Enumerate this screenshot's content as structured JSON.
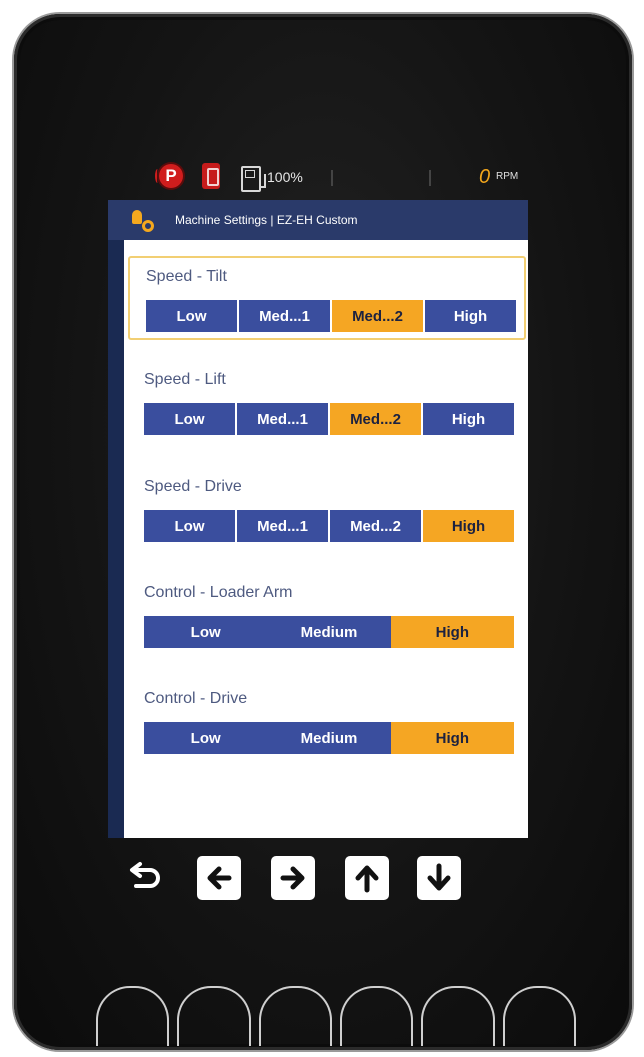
{
  "status": {
    "fuel_text": "100%",
    "rpm_value": "0",
    "rpm_unit": "RPM"
  },
  "header": {
    "title": "Machine Settings | EZ-EH Custom"
  },
  "settings": [
    {
      "label": "Speed - Tilt",
      "options": [
        "Low",
        "Med...1",
        "Med...2",
        "High"
      ],
      "selected": "Med...2"
    },
    {
      "label": "Speed - Lift",
      "options": [
        "Low",
        "Med...1",
        "Med...2",
        "High"
      ],
      "selected": "Med...2"
    },
    {
      "label": "Speed - Drive",
      "options": [
        "Low",
        "Med...1",
        "Med...2",
        "High"
      ],
      "selected": "High"
    },
    {
      "label": "Control - Loader Arm",
      "options": [
        "Low",
        "Medium",
        "High"
      ],
      "selected": "High"
    },
    {
      "label": "Control - Drive",
      "options": [
        "Low",
        "Medium",
        "High"
      ],
      "selected": "High"
    }
  ],
  "nav_icons": [
    "back-icon",
    "arrow-left-icon",
    "arrow-right-icon",
    "arrow-up-icon",
    "arrow-down-icon"
  ],
  "colors": {
    "selected": "#f5a623",
    "option": "#3a4e9e",
    "parking_brake": "#d01d1d",
    "rpm": "#f2a61c"
  }
}
